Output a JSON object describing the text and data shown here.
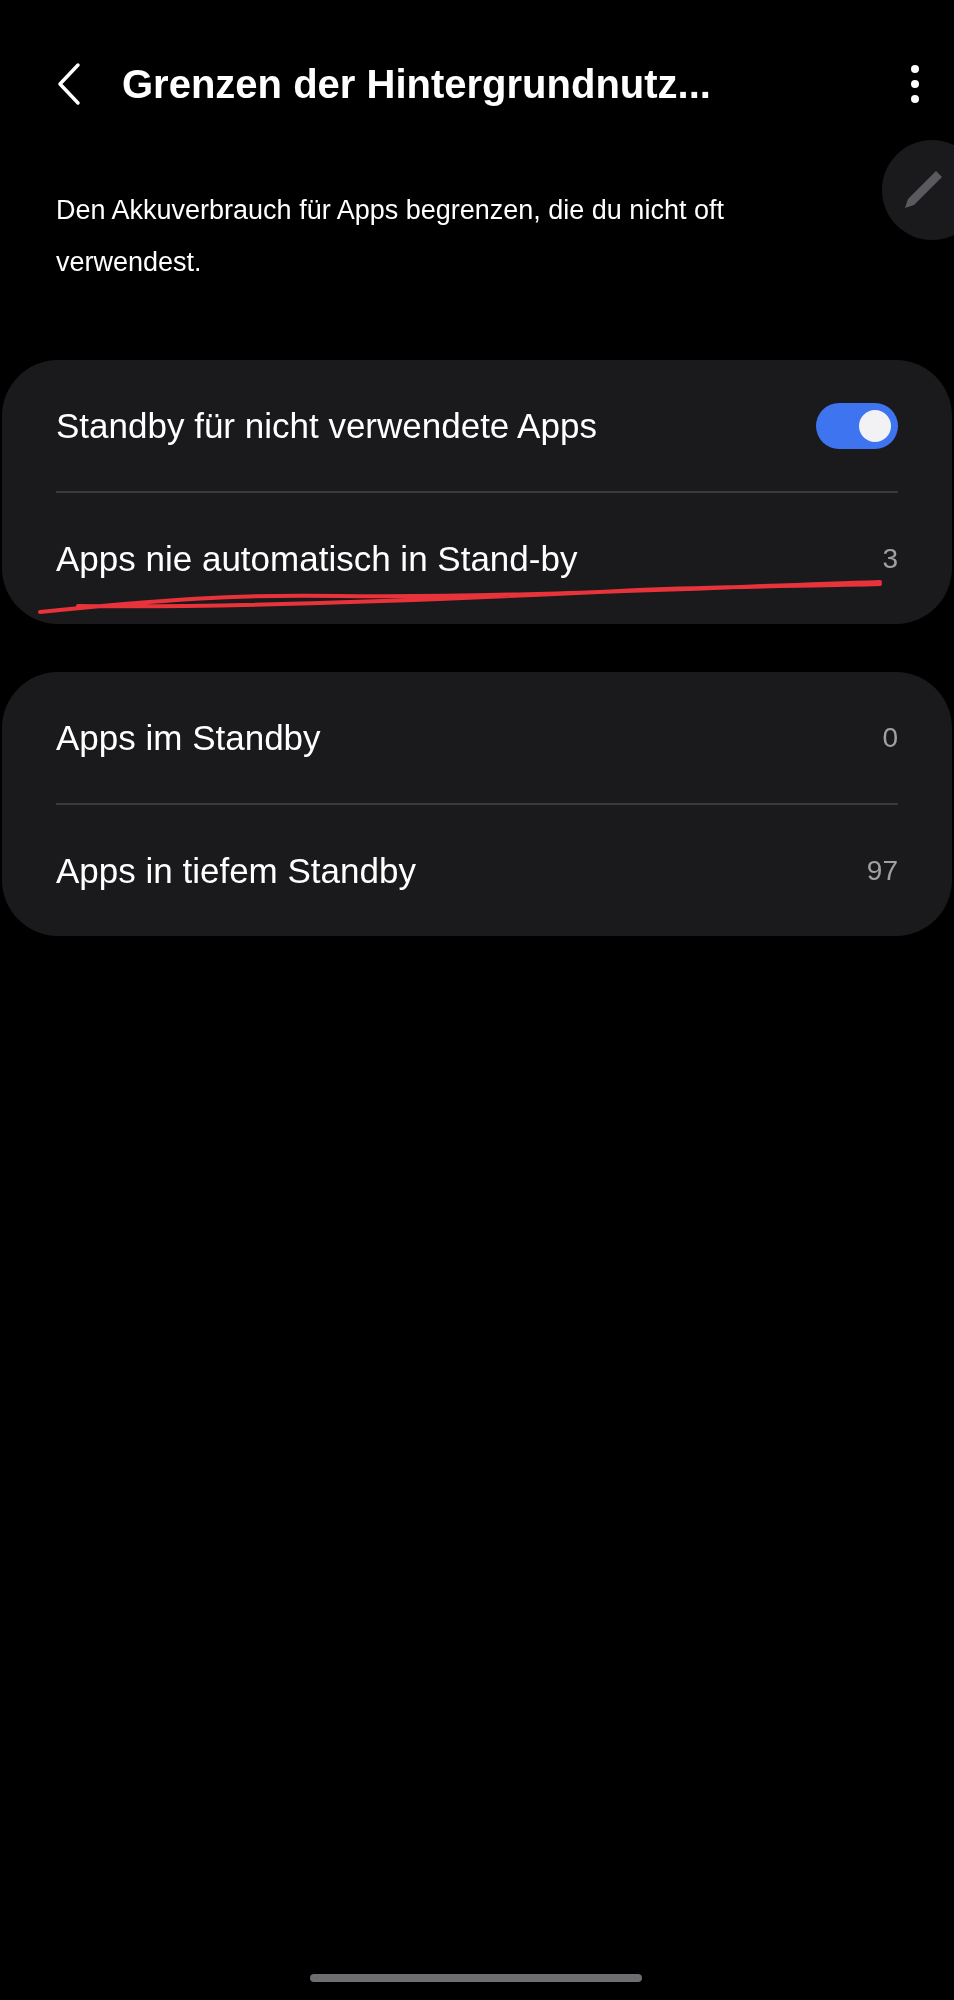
{
  "header": {
    "title": "Grenzen der Hintergrundnutz..."
  },
  "description": "Den Akkuverbrauch für Apps begrenzen, die du nicht oft verwendest.",
  "cards": [
    {
      "rows": [
        {
          "kind": "switch",
          "label": "Standby für nicht verwendete Apps",
          "on": true
        },
        {
          "kind": "count",
          "label": "Apps nie automatisch in Stand-by",
          "count": "3"
        }
      ]
    },
    {
      "rows": [
        {
          "kind": "count",
          "label": "Apps im Standby",
          "count": "0"
        },
        {
          "kind": "count",
          "label": "Apps in tiefem Standby",
          "count": "97"
        }
      ]
    }
  ]
}
